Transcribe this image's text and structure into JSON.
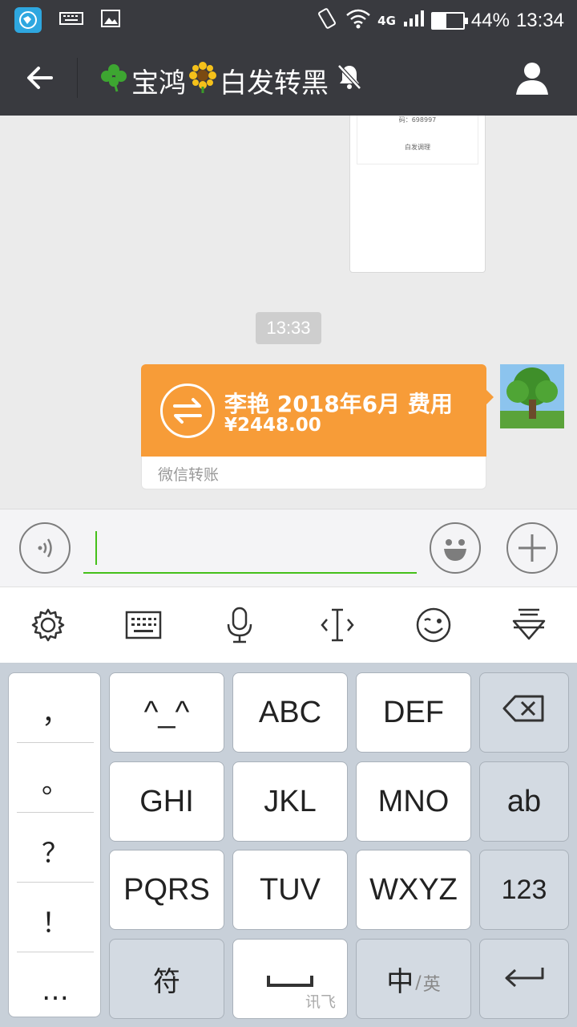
{
  "status_bar": {
    "battery_text": "44%",
    "battery_level": 0.44,
    "time": "13:34",
    "network": "4G"
  },
  "header": {
    "title_part1": "宝鸿",
    "title_part2": "白发转黑"
  },
  "chat": {
    "image_text_1": "码：698997",
    "image_text_2": "白发调理",
    "timestamp": "13:33",
    "transfer": {
      "title": "李艳 2018年6月 费用",
      "amount": "¥2448.00",
      "label": "微信转账",
      "color": "#f79c38"
    }
  },
  "input": {
    "value": "",
    "accent_color": "#45c01a"
  },
  "keyboard": {
    "toolbar": [
      "settings-icon",
      "keyboard-icon",
      "microphone-icon",
      "cursor-icon",
      "wink-emoji-icon",
      "collapse-keyboard-icon"
    ],
    "punctuation": [
      "，",
      "。",
      "？",
      "！",
      "…"
    ],
    "keys": {
      "emoticon": "^_^",
      "abc": "ABC",
      "def": "DEF",
      "ghi": "GHI",
      "jkl": "JKL",
      "mno": "MNO",
      "ab": "ab",
      "pqrs": "PQRS",
      "tuv": "TUV",
      "wxyz": "WXYZ",
      "num": "123",
      "symbol": "符",
      "space_brand": "讯飞",
      "zh": "中",
      "en": "英"
    }
  }
}
